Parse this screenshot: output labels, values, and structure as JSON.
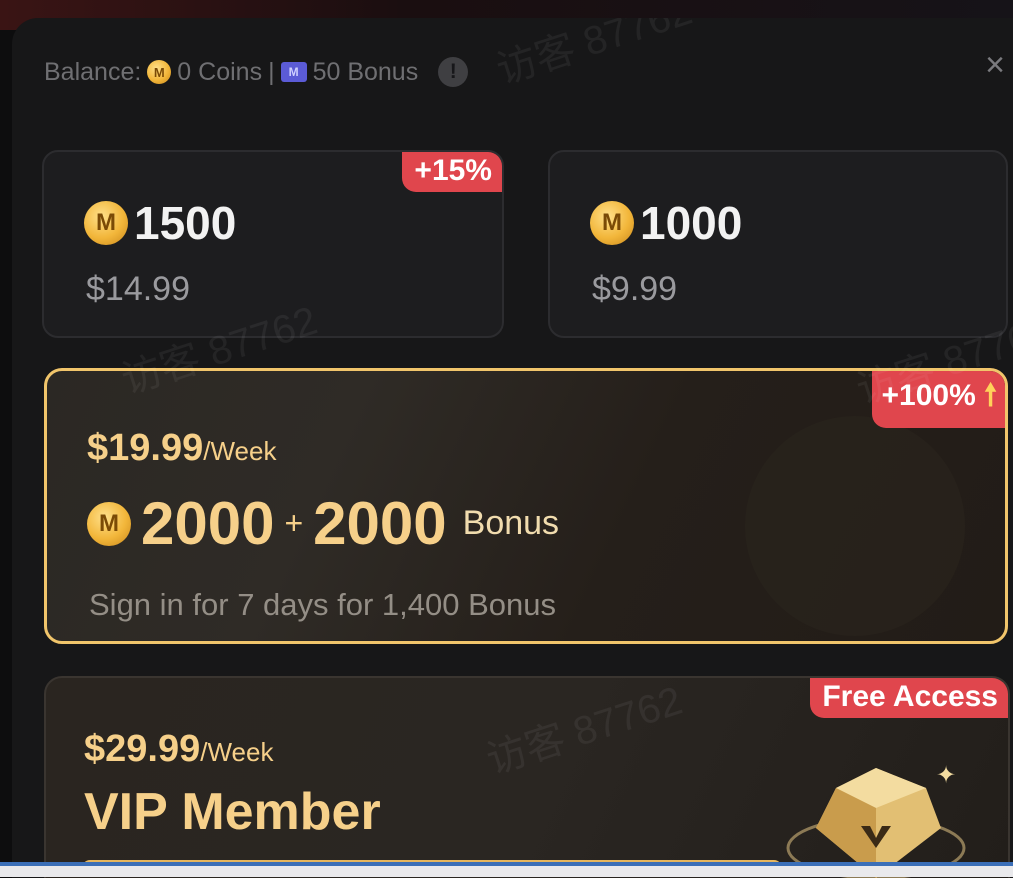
{
  "balance": {
    "label": "Balance:",
    "coins": "0 Coins",
    "separator": "|",
    "bonus": "50 Bonus",
    "info_icon": "!"
  },
  "close_icon": "×",
  "coin_symbol": "M",
  "ticket_symbol": "M",
  "packages": [
    {
      "amount": "1500",
      "price": "$14.99",
      "tag": "+15%"
    },
    {
      "amount": "1000",
      "price": "$9.99",
      "tag": ""
    }
  ],
  "weekly_pack": {
    "price": "$19.99",
    "unit": "/Week",
    "coins": "2000",
    "plus": "+",
    "bonus_amount": "2000",
    "bonus_label": "Bonus",
    "signin_text": "Sign in for 7 days for 1,400 Bonus",
    "tag": "+100%",
    "tag_icon": "🠕"
  },
  "vip_pack": {
    "price": "$29.99",
    "unit": "/Week",
    "title": "VIP Member",
    "tag": "Free Access"
  },
  "watermark": "访客 87762",
  "colors": {
    "accent_gold": "#f6d08a",
    "tag_red": "#e0464d",
    "selected_border": "#f1c56b"
  }
}
